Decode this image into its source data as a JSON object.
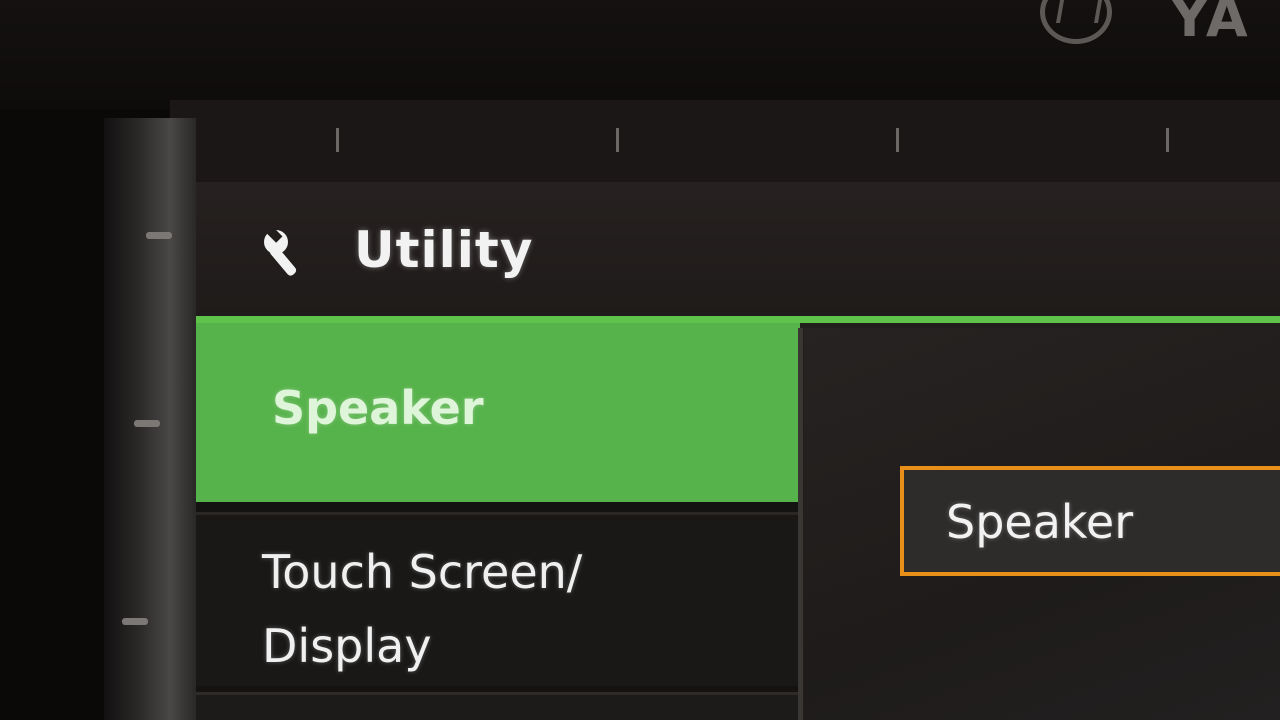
{
  "device": {
    "brand_text": "YA"
  },
  "header": {
    "icon": "wrench-icon",
    "title": "Utility"
  },
  "sidebar": {
    "items": [
      {
        "label": "Speaker",
        "selected": true
      },
      {
        "label": "Touch Screen/ Display",
        "selected": false
      }
    ]
  },
  "content": {
    "focused_option": "Speaker"
  },
  "colors": {
    "accent_green": "#56b24a",
    "focus_orange": "#e88f1a"
  }
}
